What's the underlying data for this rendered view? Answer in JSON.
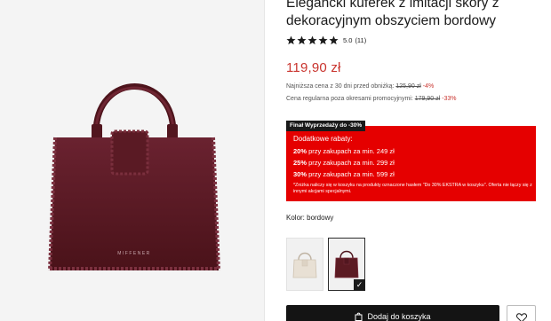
{
  "product": {
    "title": "Elegancki kuferek z imitacji skóry z dekoracyjnym obszyciem bordowy",
    "rating_value": "5.0",
    "rating_count": "(11)",
    "rating_stars": 5,
    "price": "119,90 zł",
    "lowest_price_label": "Najniższa cena z 30 dni przed obniżką: ",
    "lowest_price_old": "125,90 zł",
    "lowest_price_discount": "-4%",
    "regular_price_label": "Cena regularna poza okresami promocyjnymi: ",
    "regular_price_old": "179,90 zł",
    "regular_price_discount": "-33%"
  },
  "promo": {
    "tag": "Finał Wyprzedaży do -30%",
    "heading": "Dodatkowe rabaty:",
    "tiers": [
      {
        "bold": "20%",
        "text": " przy zakupach za min. 249 zł"
      },
      {
        "bold": "25%",
        "text": " przy zakupach za min. 299 zł"
      },
      {
        "bold": "30%",
        "text": " przy zakupach za min. 599 zł"
      }
    ],
    "note": "*Zniżka naliczy się w koszyku na produkty oznaczone hasłem \"Do 30% EKSTRA w koszyku\". Oferta nie łączy się z innymi akcjami specjalnymi.",
    "color": "#e50000"
  },
  "color_selector": {
    "label": "Kolor: bordowy",
    "options": [
      "beżowy",
      "bordowy"
    ],
    "selected": "bordowy"
  },
  "actions": {
    "add_to_cart": "Dodaj do koszyka"
  },
  "colors": {
    "price": "#c9342e",
    "bag_main": "#5b1a22",
    "button": "#141414"
  },
  "bag_brand": "MIFFENER"
}
